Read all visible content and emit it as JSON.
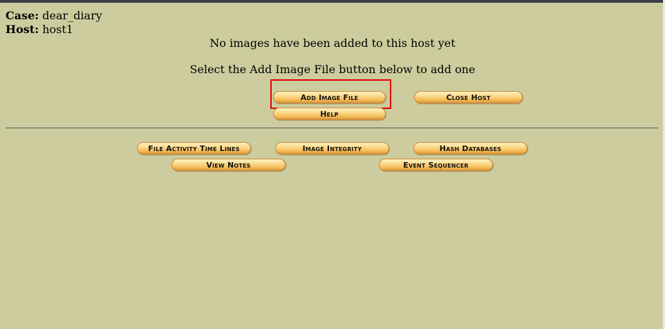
{
  "case": {
    "label": "Case:",
    "value": "dear_diary"
  },
  "host": {
    "label": "Host:",
    "value": "host1"
  },
  "messages": {
    "no_images": "No images have been added to this host yet",
    "instruction": "Select the Add Image File button below to add one"
  },
  "buttons": {
    "add_image_file": "Add Image File",
    "close_host": "Close Host",
    "help": "Help",
    "file_activity_time_lines": "File Activity Time Lines",
    "image_integrity": "Image Integrity",
    "hash_databases": "Hash Databases",
    "view_notes": "View Notes",
    "event_sequencer": "Event Sequencer"
  },
  "colors": {
    "background": "#cccc9e",
    "highlight": "#e00000",
    "button": "#f4bb56"
  }
}
